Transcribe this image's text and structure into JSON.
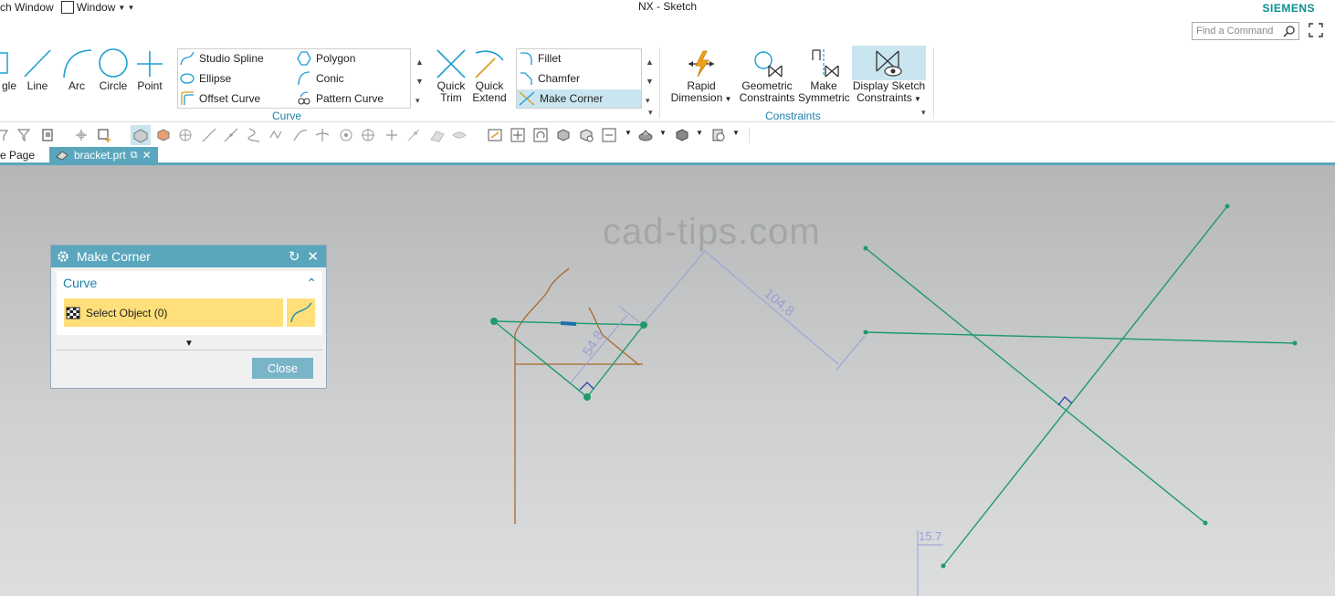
{
  "titlebar": {
    "menu_switch_window": "ch Window",
    "menu_window": "Window",
    "app_title": "NX - Sketch",
    "brand": "SIEMENS"
  },
  "command_finder": {
    "placeholder": "Find a Command"
  },
  "ribbon": {
    "create": {
      "rectangle": "gle",
      "line": "Line",
      "arc": "Arc",
      "circle": "Circle",
      "point": "Point"
    },
    "curve_gallery": {
      "studio_spline": "Studio Spline",
      "polygon": "Polygon",
      "ellipse": "Ellipse",
      "conic": "Conic",
      "offset_curve": "Offset Curve",
      "pattern_curve": "Pattern Curve",
      "group_label": "Curve"
    },
    "edit": {
      "quick_trim_1": "Quick",
      "quick_trim_2": "Trim",
      "quick_extend_1": "Quick",
      "quick_extend_2": "Extend"
    },
    "corner_gallery": {
      "fillet": "Fillet",
      "chamfer": "Chamfer",
      "make_corner": "Make Corner"
    },
    "constraints": {
      "rapid_1": "Rapid",
      "rapid_2": "Dimension",
      "geometric_1": "Geometric",
      "geometric_2": "Constraints",
      "symmetric_1": "Make",
      "symmetric_2": "Symmetric",
      "display_1": "Display Sketch",
      "display_2": "Constraints",
      "group_label": "Constraints"
    }
  },
  "tabs": {
    "home": "e Page",
    "file": "bracket.prt"
  },
  "canvas": {
    "watermark": "cad-tips.com",
    "dim_104": "104.8",
    "dim_54": "54.8",
    "dim_15": "15.7"
  },
  "dialog": {
    "title": "Make Corner",
    "section": "Curve",
    "select_label": "Select Object (0)",
    "close_label": "Close"
  },
  "colors": {
    "accent": "#5aa6bd",
    "sketch_green": "#1f9a6a",
    "highlight_yellow": "#ffdf7a",
    "brand": "#0a8f8f"
  }
}
